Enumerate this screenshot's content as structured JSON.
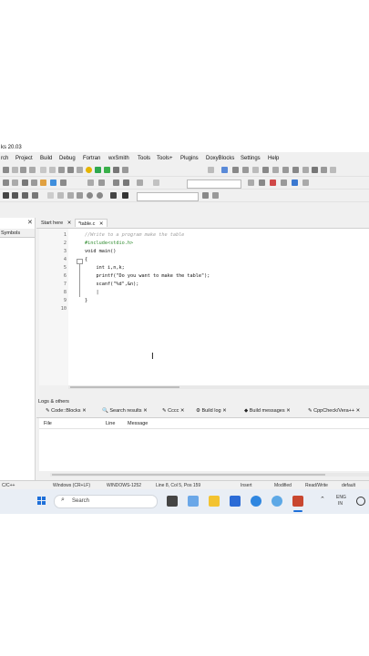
{
  "window": {
    "title": "ks 20.03"
  },
  "menu": [
    "rch",
    "Project",
    "Build",
    "Debug",
    "Fortran",
    "wxSmith",
    "Tools",
    "Tools+",
    "Plugins",
    "DoxyBlocks",
    "Settings",
    "Help"
  ],
  "sidebar": {
    "label": "Symbols"
  },
  "tabs": {
    "start": "Start here",
    "file": "*table.c"
  },
  "editor": {
    "line_numbers": [
      "1",
      "2",
      "3",
      "4",
      "5",
      "6",
      "7",
      "8",
      "9",
      "10"
    ],
    "lines": [
      "//Write to a program make the table",
      "#include<stdio.h>",
      "void main()",
      "{",
      "    int i,n,k;",
      "    printf(\"Do you want to make the table\");",
      "    scanf(\"%d\",&n);",
      "    |",
      "}",
      ""
    ]
  },
  "logs": {
    "title": "Logs & others",
    "tabs": [
      "Code::Blocks",
      "Search results",
      "Cccc",
      "Build log",
      "Build messages",
      "CppCheck/Vera++"
    ],
    "columns": [
      "File",
      "Line",
      "Message"
    ]
  },
  "status": {
    "lang": "C/C++",
    "eol": "Windows (CR+LF)",
    "encoding": "WINDOWS-1252",
    "position": "Line 8, Col 5, Pos 159",
    "mode": "Insert",
    "modified": "Modified",
    "rw": "Read/Write",
    "profile": "default"
  },
  "taskbar": {
    "search": "Search",
    "lang": "ENG",
    "region": "IN"
  },
  "colors": {
    "accent": "#1e6fd9",
    "comment": "#a0a0a0",
    "preproc": "#2e8b2e",
    "keyword": "#1a1aa6"
  }
}
